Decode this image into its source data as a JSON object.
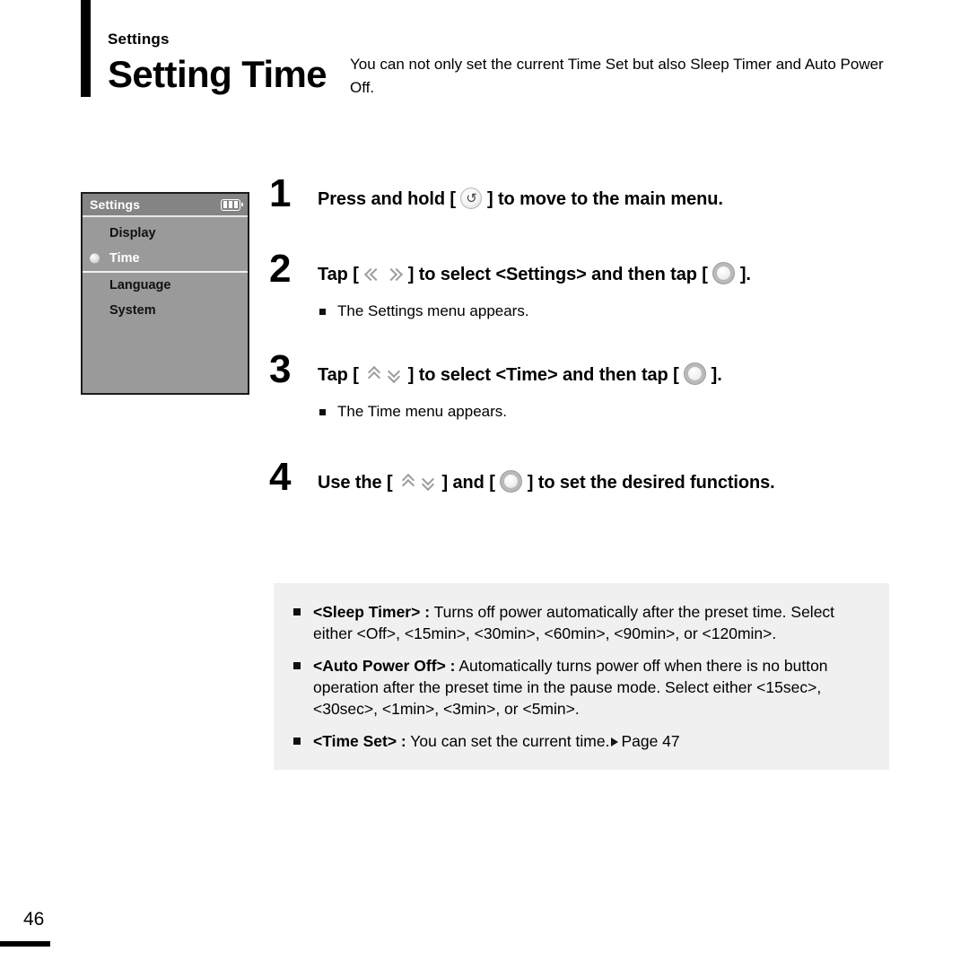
{
  "header": {
    "eyebrow": "Settings",
    "title": "Setting Time",
    "description": "You can not only set the current Time Set but also Sleep Timer and Auto Power Off."
  },
  "device_screen": {
    "title": "Settings",
    "battery_icon": "battery-icon",
    "battery_bars": 3,
    "items": [
      {
        "label": "Display",
        "selected": false
      },
      {
        "label": "Time",
        "selected": true
      },
      {
        "label": "Language",
        "selected": false
      },
      {
        "label": "System",
        "selected": false
      }
    ]
  },
  "steps": [
    {
      "number": "1",
      "text_before": "Press and hold [",
      "icon": "back-return-icon",
      "icon_glyph": "↺",
      "text_after": "] to move to the main menu.",
      "sub": ""
    },
    {
      "number": "2",
      "text_before": "Tap [",
      "icon": "left-right-chevron-icon",
      "text_mid": "] to select <Settings> and then tap [",
      "icon2": "select-button-icon",
      "text_after": "].",
      "sub": "The Settings menu appears."
    },
    {
      "number": "3",
      "text_before": "Tap [",
      "icon": "up-down-chevron-icon",
      "text_mid": "] to select <Time> and then tap [",
      "icon2": "select-button-icon",
      "text_after": "].",
      "sub": "The Time menu appears."
    },
    {
      "number": "4",
      "text_before": "Use the [",
      "icon": "up-down-chevron-icon",
      "text_mid": "] and [",
      "icon2": "select-button-icon",
      "text_after": "] to set the desired functions.",
      "sub": ""
    }
  ],
  "note_box": {
    "items": [
      {
        "term": "<Sleep Timer> :",
        "body": " Turns off power automatically after the preset time. Select either <Off>, <15min>, <30min>, <60min>, <90min>, or <120min>."
      },
      {
        "term": "<Auto Power Off> :",
        "body": " Automatically turns power off when there is no button operation after the preset time in the pause mode. Select either <15sec>, <30sec>, <1min>, <3min>, or <5min>."
      },
      {
        "term": "<Time Set> :",
        "body": " You can set the current time.",
        "page_ref": "Page 47"
      }
    ]
  },
  "footer": {
    "page_number": "46"
  },
  "colors": {
    "accent_bar": "#000000",
    "device_bg": "#9a9a9a",
    "device_titlebar": "#848484",
    "note_bg": "#f0f0f0",
    "text": "#000000"
  }
}
